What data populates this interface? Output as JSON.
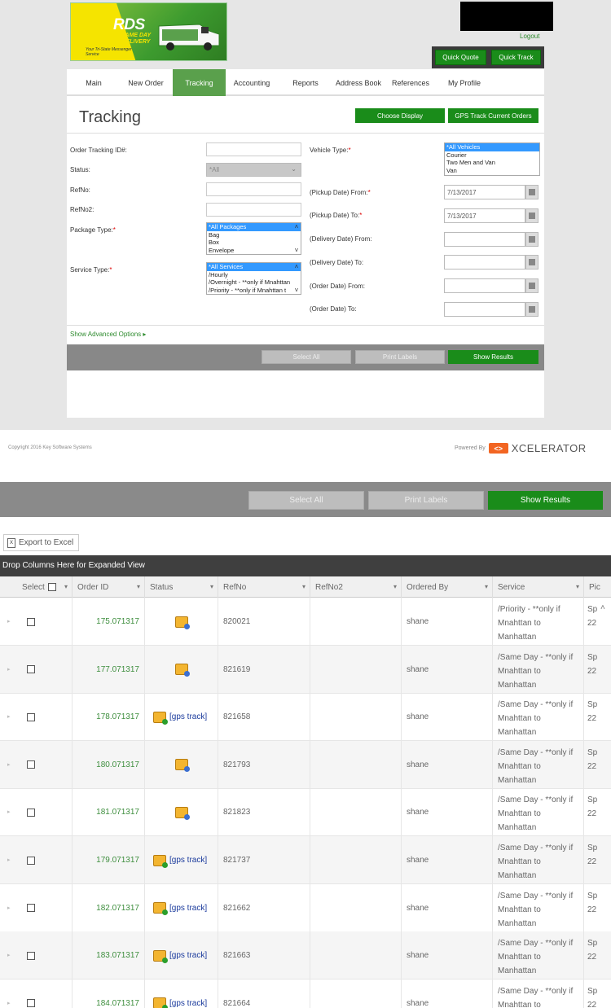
{
  "header": {
    "logo_text": "RDS",
    "logo_subtitle": "SAME DAY DELIVERY",
    "logo_tagline": "Your Tri-State Messenger Service",
    "logout": "Logout",
    "quick_quote": "Quick Quote",
    "quick_track": "Quick Track"
  },
  "nav": [
    "Main",
    "New Order",
    "Tracking",
    "Accounting",
    "Reports",
    "Address Book",
    "References",
    "My Profile"
  ],
  "page": {
    "title": "Tracking",
    "choose_display": "Choose Display",
    "gps_track_current": "GPS Track Current Orders"
  },
  "form": {
    "order_tracking_id": "Order Tracking ID#:",
    "status": "Status:",
    "status_value": "*All",
    "refno": "RefNo:",
    "refno2": "RefNo2:",
    "package_type": "Package Type:",
    "package_options": [
      "*All Packages",
      "Bag",
      "Box",
      "Envelope"
    ],
    "service_type": "Service Type:",
    "service_options": [
      "*All Services",
      "/Hourly",
      "/Overnight - **only if Mnahttan",
      "/Priority - **only if Mnahttan t"
    ],
    "vehicle_type": "Vehicle Type:",
    "vehicle_options": [
      "*All Vehicles",
      "Courier",
      "Two Men and Van",
      "Van"
    ],
    "pickup_from": "(Pickup Date) From:",
    "pickup_from_value": "7/13/2017",
    "pickup_to": "(Pickup Date) To:",
    "pickup_to_value": "7/13/2017",
    "delivery_from": "(Delivery Date) From:",
    "delivery_to": "(Delivery Date) To:",
    "order_from": "(Order Date) From:",
    "order_to": "(Order Date) To:",
    "advanced": "Show Advanced Options"
  },
  "actions": {
    "select_all": "Select All",
    "print_labels": "Print Labels",
    "show_results": "Show Results"
  },
  "footer": {
    "copyright": "Copyright 2016 Key Software Systems",
    "powered_by": "Powered By",
    "brand": "XCELERATOR"
  },
  "grid": {
    "export": "Export to Excel",
    "drop_columns": "Drop Columns Here for Expanded View",
    "columns": [
      "Select",
      "Order ID",
      "Status",
      "RefNo",
      "RefNo2",
      "Ordered By",
      "Service",
      "Pic"
    ],
    "gps_label": "[gps track]",
    "rows": [
      {
        "order_id": "175.071317",
        "gps": false,
        "refno": "820021",
        "refno2": "",
        "ordered_by": "shane",
        "service": "/Priority - **only if Mnahttan to Manhattan",
        "pickup": "Sp 22"
      },
      {
        "order_id": "177.071317",
        "gps": false,
        "refno": "821619",
        "refno2": "",
        "ordered_by": "shane",
        "service": "/Same Day - **only if Mnahttan to Manhattan",
        "pickup": "Sp 22"
      },
      {
        "order_id": "178.071317",
        "gps": true,
        "refno": "821658",
        "refno2": "",
        "ordered_by": "shane",
        "service": "/Same Day - **only if Mnahttan to Manhattan",
        "pickup": "Sp 22"
      },
      {
        "order_id": "180.071317",
        "gps": false,
        "refno": "821793",
        "refno2": "",
        "ordered_by": "shane",
        "service": "/Same Day - **only if Mnahttan to Manhattan",
        "pickup": "Sp 22"
      },
      {
        "order_id": "181.071317",
        "gps": false,
        "refno": "821823",
        "refno2": "",
        "ordered_by": "shane",
        "service": "/Same Day - **only if Mnahttan to Manhattan",
        "pickup": "Sp 22"
      },
      {
        "order_id": "179.071317",
        "gps": true,
        "refno": "821737",
        "refno2": "",
        "ordered_by": "shane",
        "service": "/Same Day - **only if Mnahttan to Manhattan",
        "pickup": "Sp 22"
      },
      {
        "order_id": "182.071317",
        "gps": true,
        "refno": "821662",
        "refno2": "",
        "ordered_by": "shane",
        "service": "/Same Day - **only if Mnahttan to Manhattan",
        "pickup": "Sp 22"
      },
      {
        "order_id": "183.071317",
        "gps": true,
        "refno": "821663",
        "refno2": "",
        "ordered_by": "shane",
        "service": "/Same Day - **only if Mnahttan to Manhattan",
        "pickup": "Sp 22"
      },
      {
        "order_id": "184.071317",
        "gps": true,
        "refno": "821664",
        "refno2": "",
        "ordered_by": "shane",
        "service": "/Same Day - **only if Mnahttan to",
        "pickup": "Sp 22"
      }
    ]
  }
}
